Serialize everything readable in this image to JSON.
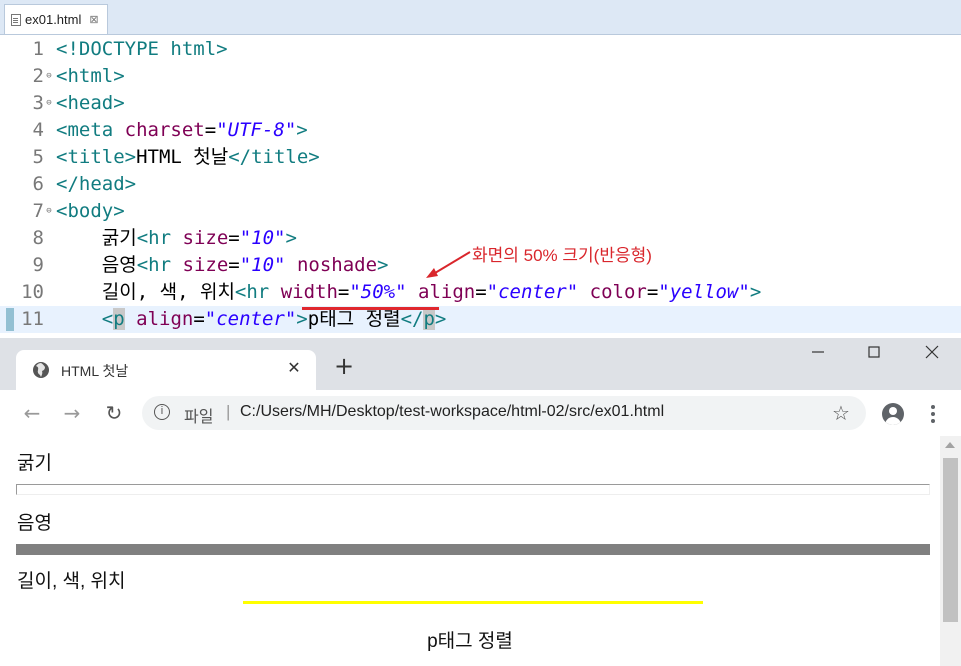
{
  "editor": {
    "tab": {
      "filename": "ex01.html",
      "close": "⊠"
    },
    "lines": [
      {
        "n": "1"
      },
      {
        "n": "2"
      },
      {
        "n": "3"
      },
      {
        "n": "4"
      },
      {
        "n": "5"
      },
      {
        "n": "6"
      },
      {
        "n": "7"
      },
      {
        "n": "8"
      },
      {
        "n": "9"
      },
      {
        "n": "10"
      },
      {
        "n": "11"
      }
    ],
    "code": {
      "l1_doctype": "<!DOCTYPE html>",
      "l2_html": "<html>",
      "l3_head": "<head>",
      "l4_meta_open": "<meta",
      "l4_attr": "charset",
      "l4_eq": "=",
      "l4_val": "\"UTF-8\"",
      "l4_close": ">",
      "l5_open": "<title>",
      "l5_text": "HTML 첫날",
      "l5_close": "</title>",
      "l6_head_close": "</head>",
      "l7_body": "<body>",
      "l8_text": "굵기",
      "l8_tag": "<hr",
      "l8_attr": "size",
      "l8_val": "\"10\"",
      "l8_close": ">",
      "l9_text": "음영",
      "l9_tag": "<hr",
      "l9_attr": "size",
      "l9_val": "\"10\"",
      "l9_attr2": "noshade",
      "l9_close": ">",
      "l10_text": "길이, 색, 위치",
      "l10_tag": "<hr",
      "l10_attr1": "width",
      "l10_val1": "\"50%\"",
      "l10_attr2": "align",
      "l10_val2": "\"center\"",
      "l10_attr3": "color",
      "l10_val3": "\"yellow\"",
      "l10_close": ">",
      "l11_tag_lt": "<",
      "l11_tag_p": "p",
      "l11_attr": "align",
      "l11_val": "\"center\"",
      "l11_gt": ">",
      "l11_text": "p태그 정렬",
      "l11_close_lt": "</",
      "l11_close_p": "p",
      "l11_close_gt": ">"
    },
    "annotation": "화면의 50% 크기(반응형)"
  },
  "browser": {
    "tab_title": "HTML 첫날",
    "tab_close": "✕",
    "new_tab": "+",
    "scheme_label": "파일",
    "separator": "|",
    "url": "C:/Users/MH/Desktop/test-workspace/html-02/src/ex01.html",
    "content": {
      "label_thickness": "굵기",
      "label_shade": "음영",
      "label_length": "길이, 색, 위치",
      "paragraph": "p태그 정렬"
    }
  },
  "colors": {
    "tag": "#117c80",
    "attribute": "#7f0055",
    "value": "#2a00ff",
    "annotation": "#d9262c",
    "hr_yellow": "#ffff00",
    "hr_shade": "#808080"
  }
}
